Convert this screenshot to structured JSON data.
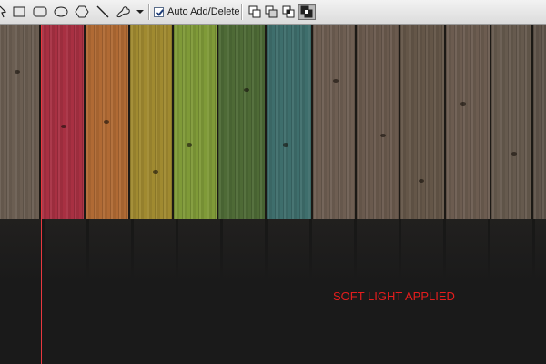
{
  "toolbar": {
    "tools": [
      {
        "name": "path-selection-icon",
        "active": false
      },
      {
        "name": "rectangle-tool-icon",
        "active": false
      },
      {
        "name": "rounded-rectangle-tool-icon",
        "active": false
      },
      {
        "name": "ellipse-tool-icon",
        "active": false
      },
      {
        "name": "polygon-tool-icon",
        "active": false
      },
      {
        "name": "line-tool-icon",
        "active": false
      },
      {
        "name": "custom-shape-tool-icon",
        "active": false
      }
    ],
    "auto_add_delete": {
      "label": "Auto Add/Delete",
      "checked": true
    },
    "path_operations": [
      {
        "name": "add-to-path-icon",
        "active": false
      },
      {
        "name": "subtract-from-path-icon",
        "active": false
      },
      {
        "name": "intersect-path-icon",
        "active": false
      },
      {
        "name": "exclude-overlap-icon",
        "active": true
      }
    ]
  },
  "canvas": {
    "caption": "SOFT LIGHT APPLIED",
    "caption_color": "#e51d1d",
    "guide_color": "#e8383f",
    "plank_tints": [
      "#6b5e52",
      "#a83042",
      "#b06a34",
      "#a08a30",
      "#7f9a38",
      "#4e6a36",
      "#3e6e6c",
      "#6e5e52",
      "#6a5a4e",
      "#645648",
      "#6c5c50",
      "#665a4e",
      "#60544a"
    ]
  }
}
